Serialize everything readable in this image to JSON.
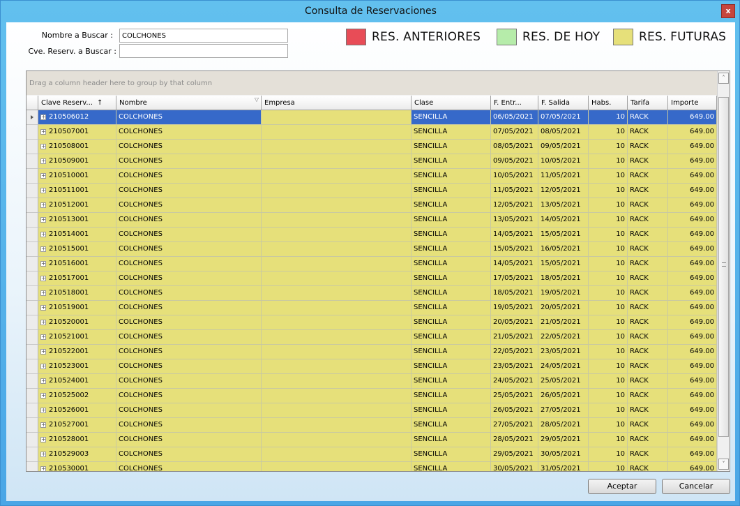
{
  "window": {
    "title": "Consulta de Reservaciones",
    "close_glyph": "x"
  },
  "search": {
    "name_label": "Nombre a Buscar :",
    "name_value": "COLCHONES",
    "key_label": "Cve. Reserv. a Buscar :",
    "key_value": ""
  },
  "legend": [
    {
      "label": "RES. ANTERIORES",
      "color": "#e84c57"
    },
    {
      "label": "RES. DE HOY",
      "color": "#b6ecaa"
    },
    {
      "label": "RES. FUTURAS",
      "color": "#e6e07a"
    }
  ],
  "grid": {
    "group_hint": "Drag a column header here to group by that column",
    "columns": [
      "Clave Reserv...",
      "Nombre",
      "Empresa",
      "Clase",
      "F. Entr...",
      "F. Salida",
      "Habs.",
      "Tarifa",
      "Importe"
    ],
    "sort_glyph": "↑",
    "filter_glyph": "▽",
    "expand_glyph": "+",
    "row_color": "#e6e07a",
    "selected_color": "#3669c9",
    "rows": [
      [
        "210506012",
        "COLCHONES",
        "",
        "SENCILLA",
        "06/05/2021",
        "07/05/2021",
        "10",
        "RACK",
        "649.00"
      ],
      [
        "210507001",
        "COLCHONES",
        "",
        "SENCILLA",
        "07/05/2021",
        "08/05/2021",
        "10",
        "RACK",
        "649.00"
      ],
      [
        "210508001",
        "COLCHONES",
        "",
        "SENCILLA",
        "08/05/2021",
        "09/05/2021",
        "10",
        "RACK",
        "649.00"
      ],
      [
        "210509001",
        "COLCHONES",
        "",
        "SENCILLA",
        "09/05/2021",
        "10/05/2021",
        "10",
        "RACK",
        "649.00"
      ],
      [
        "210510001",
        "COLCHONES",
        "",
        "SENCILLA",
        "10/05/2021",
        "11/05/2021",
        "10",
        "RACK",
        "649.00"
      ],
      [
        "210511001",
        "COLCHONES",
        "",
        "SENCILLA",
        "11/05/2021",
        "12/05/2021",
        "10",
        "RACK",
        "649.00"
      ],
      [
        "210512001",
        "COLCHONES",
        "",
        "SENCILLA",
        "12/05/2021",
        "13/05/2021",
        "10",
        "RACK",
        "649.00"
      ],
      [
        "210513001",
        "COLCHONES",
        "",
        "SENCILLA",
        "13/05/2021",
        "14/05/2021",
        "10",
        "RACK",
        "649.00"
      ],
      [
        "210514001",
        "COLCHONES",
        "",
        "SENCILLA",
        "14/05/2021",
        "15/05/2021",
        "10",
        "RACK",
        "649.00"
      ],
      [
        "210515001",
        "COLCHONES",
        "",
        "SENCILLA",
        "15/05/2021",
        "16/05/2021",
        "10",
        "RACK",
        "649.00"
      ],
      [
        "210516001",
        "COLCHONES",
        "",
        "SENCILLA",
        "14/05/2021",
        "15/05/2021",
        "10",
        "RACK",
        "649.00"
      ],
      [
        "210517001",
        "COLCHONES",
        "",
        "SENCILLA",
        "17/05/2021",
        "18/05/2021",
        "10",
        "RACK",
        "649.00"
      ],
      [
        "210518001",
        "COLCHONES",
        "",
        "SENCILLA",
        "18/05/2021",
        "19/05/2021",
        "10",
        "RACK",
        "649.00"
      ],
      [
        "210519001",
        "COLCHONES",
        "",
        "SENCILLA",
        "19/05/2021",
        "20/05/2021",
        "10",
        "RACK",
        "649.00"
      ],
      [
        "210520001",
        "COLCHONES",
        "",
        "SENCILLA",
        "20/05/2021",
        "21/05/2021",
        "10",
        "RACK",
        "649.00"
      ],
      [
        "210521001",
        "COLCHONES",
        "",
        "SENCILLA",
        "21/05/2021",
        "22/05/2021",
        "10",
        "RACK",
        "649.00"
      ],
      [
        "210522001",
        "COLCHONES",
        "",
        "SENCILLA",
        "22/05/2021",
        "23/05/2021",
        "10",
        "RACK",
        "649.00"
      ],
      [
        "210523001",
        "COLCHONES",
        "",
        "SENCILLA",
        "23/05/2021",
        "24/05/2021",
        "10",
        "RACK",
        "649.00"
      ],
      [
        "210524001",
        "COLCHONES",
        "",
        "SENCILLA",
        "24/05/2021",
        "25/05/2021",
        "10",
        "RACK",
        "649.00"
      ],
      [
        "210525002",
        "COLCHONES",
        "",
        "SENCILLA",
        "25/05/2021",
        "26/05/2021",
        "10",
        "RACK",
        "649.00"
      ],
      [
        "210526001",
        "COLCHONES",
        "",
        "SENCILLA",
        "26/05/2021",
        "27/05/2021",
        "10",
        "RACK",
        "649.00"
      ],
      [
        "210527001",
        "COLCHONES",
        "",
        "SENCILLA",
        "27/05/2021",
        "28/05/2021",
        "10",
        "RACK",
        "649.00"
      ],
      [
        "210528001",
        "COLCHONES",
        "",
        "SENCILLA",
        "28/05/2021",
        "29/05/2021",
        "10",
        "RACK",
        "649.00"
      ],
      [
        "210529003",
        "COLCHONES",
        "",
        "SENCILLA",
        "29/05/2021",
        "30/05/2021",
        "10",
        "RACK",
        "649.00"
      ],
      [
        "210530001",
        "COLCHONES",
        "",
        "SENCILLA",
        "30/05/2021",
        "31/05/2021",
        "10",
        "RACK",
        "649.00"
      ]
    ]
  },
  "scrollbar": {
    "up_glyph": "˄",
    "down_glyph": "˅"
  },
  "buttons": {
    "accept": "Aceptar",
    "cancel": "Cancelar"
  }
}
